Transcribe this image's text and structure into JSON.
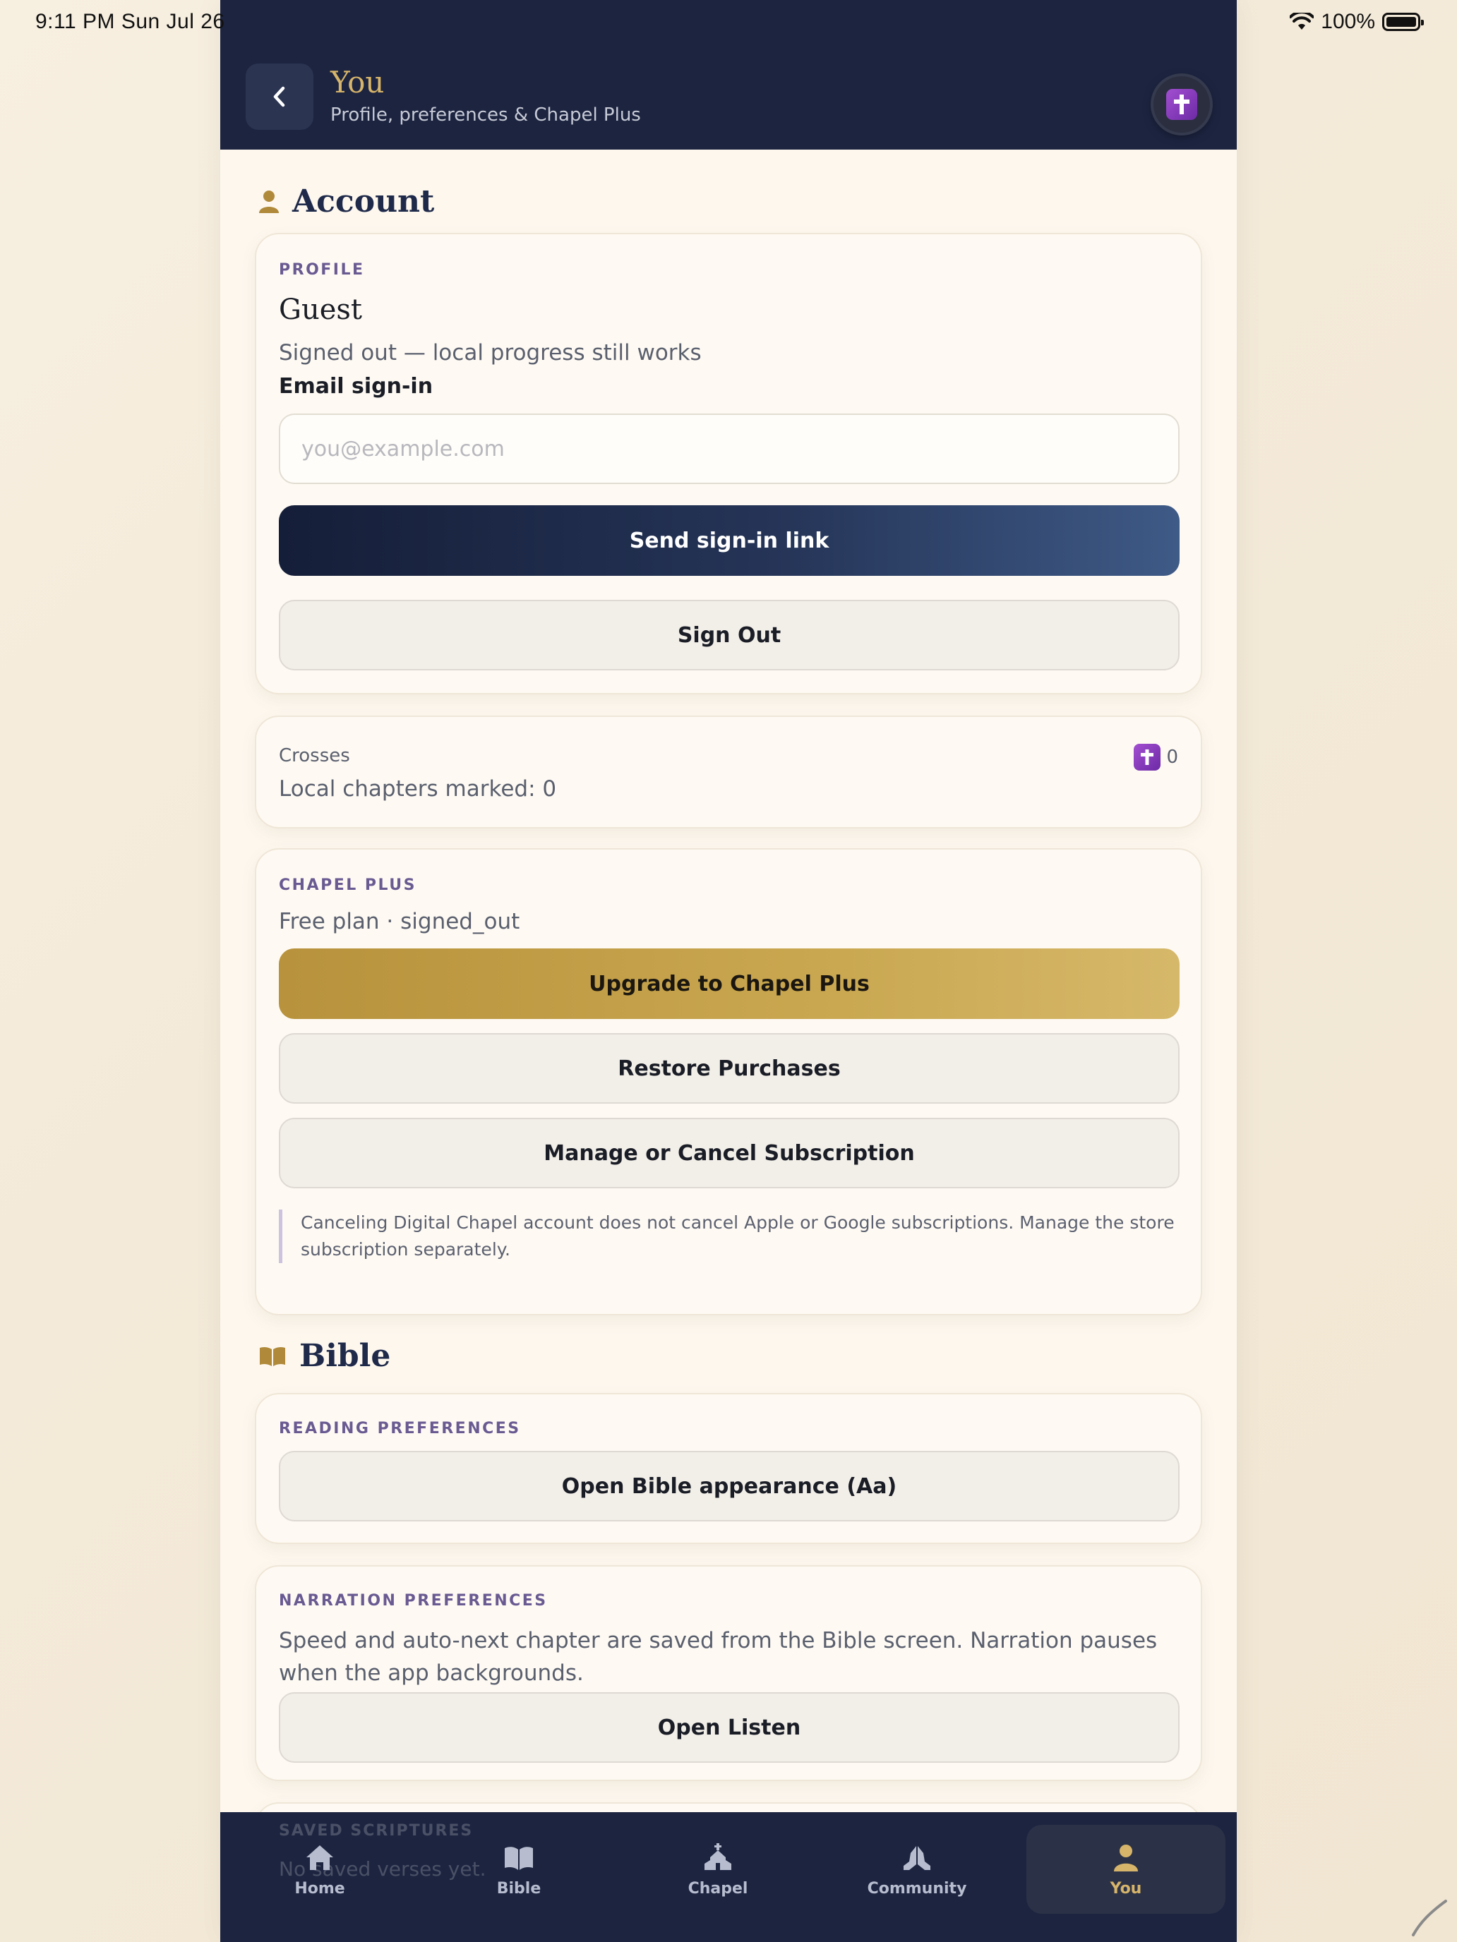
{
  "status_bar": {
    "time": "9:11 PM   Sun Jul 26",
    "battery": "100%"
  },
  "header": {
    "title": "You",
    "subtitle": "Profile, preferences & Chapel Plus"
  },
  "account": {
    "heading": "Account",
    "profile_kicker": "PROFILE",
    "name": "Guest",
    "status": "Signed out — local progress still works",
    "email_label": "Email sign-in",
    "email_value": "",
    "email_placeholder": "you@example.com",
    "send_link_label": "Send sign-in link",
    "sign_out_label": "Sign Out"
  },
  "crosses": {
    "label": "Crosses",
    "chapters": "Local chapters marked: 0",
    "count": "0"
  },
  "chapel_plus": {
    "kicker": "CHAPEL PLUS",
    "plan": "Free plan · signed_out",
    "upgrade_label": "Upgrade to Chapel Plus",
    "restore_label": "Restore Purchases",
    "manage_label": "Manage or Cancel Subscription",
    "note": "Canceling Digital Chapel account does not cancel Apple or Google subscriptions. Manage the store subscription separately."
  },
  "bible": {
    "heading": "Bible",
    "reading_kicker": "READING PREFERENCES",
    "appearance_label": "Open Bible appearance (Aa)",
    "narration_kicker": "NARRATION PREFERENCES",
    "narration_text": "Speed and auto-next chapter are saved from the Bible screen. Narration pauses when the app backgrounds.",
    "listen_label": "Open Listen",
    "saved_kicker": "SAVED SCRIPTURES",
    "saved_text": "No saved verses yet."
  },
  "tabs": [
    {
      "label": "Home",
      "icon": "home-icon"
    },
    {
      "label": "Bible",
      "icon": "book-icon"
    },
    {
      "label": "Chapel",
      "icon": "chapel-icon"
    },
    {
      "label": "Community",
      "icon": "praying-hands-icon"
    },
    {
      "label": "You",
      "icon": "person-icon",
      "active": true
    }
  ],
  "colors": {
    "navy": "#1c2440",
    "gold": "#d6b46a",
    "purple_kicker": "#6a5a92",
    "cream": "#fdf7ee"
  }
}
